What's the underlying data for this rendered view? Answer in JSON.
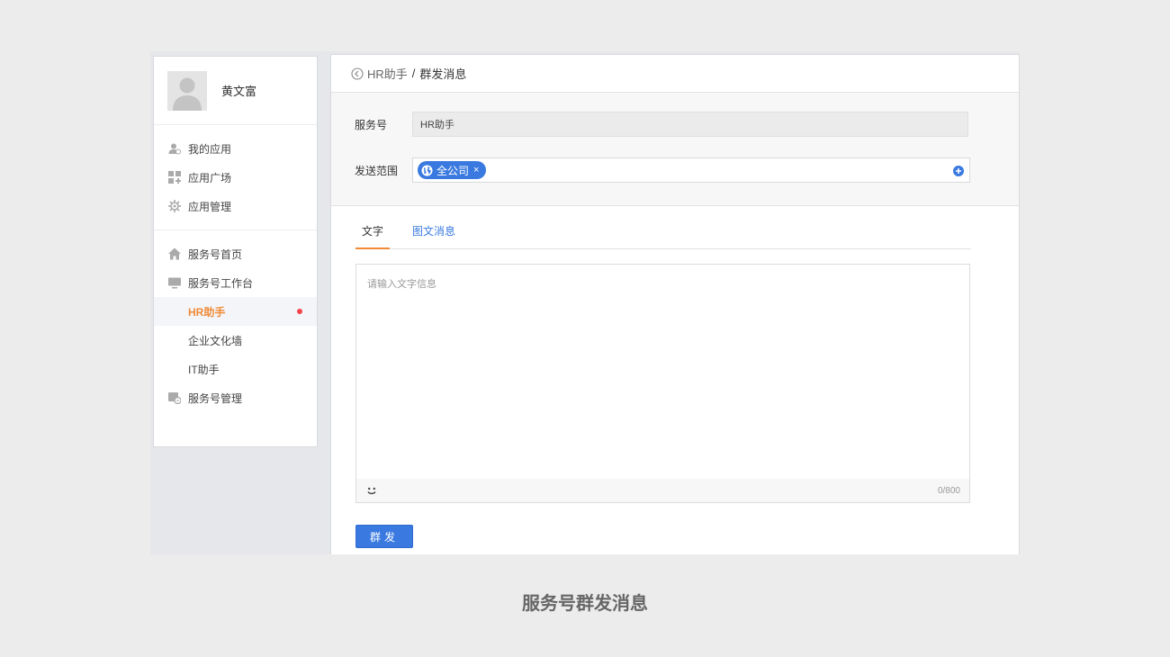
{
  "profile": {
    "name": "黄文富"
  },
  "sidebar": {
    "apps": [
      {
        "label": "我的应用",
        "icon": "user-app-icon"
      },
      {
        "label": "应用广场",
        "icon": "grid-icon"
      },
      {
        "label": "应用管理",
        "icon": "gear-icon"
      }
    ],
    "service": {
      "home": "服务号首页",
      "workbench": "服务号工作台",
      "sub_items": [
        {
          "label": "HR助手",
          "active": true,
          "has_dot": true
        },
        {
          "label": "企业文化墙"
        },
        {
          "label": "IT助手"
        }
      ],
      "manage": "服务号管理"
    }
  },
  "header": {
    "crumb_link": "HR助手",
    "separator": "/",
    "current": "群发消息"
  },
  "form": {
    "account_label": "服务号",
    "account_value": "HR助手",
    "scope_label": "发送范围",
    "scope_tag": "全公司",
    "tag_close": "×"
  },
  "tabs": {
    "text": "文字",
    "rich": "图文消息"
  },
  "editor": {
    "placeholder": "请输入文字信息",
    "counter": "0/800"
  },
  "send_label": "群发",
  "caption": "服务号群发消息",
  "colors": {
    "accent": "#3a7ae0",
    "active_orange": "#f08a35",
    "dot_red": "#f5444a"
  }
}
